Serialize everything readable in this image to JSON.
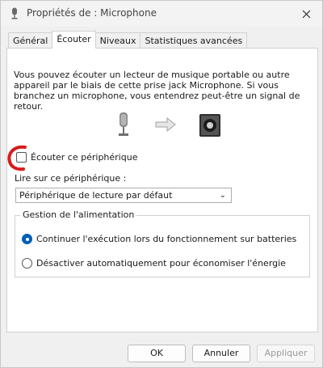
{
  "window": {
    "title": "Propriétés de : Microphone"
  },
  "tabs": [
    {
      "label": "Général"
    },
    {
      "label": "Écouter"
    },
    {
      "label": "Niveaux"
    },
    {
      "label": "Statistiques avancées"
    }
  ],
  "listen": {
    "description": "Vous pouvez écouter un lecteur de musique portable ou autre appareil par le biais de cette prise jack Microphone. Si vous branchez un microphone, vous entendrez peut-être un signal de retour.",
    "checkbox_label": "Écouter ce périphérique",
    "play_on_label": "Lire sur ce périphérique :",
    "play_on_value": "Périphérique de lecture par défaut"
  },
  "power": {
    "group_title": "Gestion de l'alimentation",
    "option_continue": "Continuer l'exécution lors du fonctionnement sur batteries",
    "option_disable": "Désactiver automatiquement pour économiser l'énergie"
  },
  "buttons": {
    "ok": "OK",
    "cancel": "Annuler",
    "apply": "Appliquer"
  },
  "colors": {
    "accent": "#005fb8",
    "annotation": "#d81b1b"
  }
}
